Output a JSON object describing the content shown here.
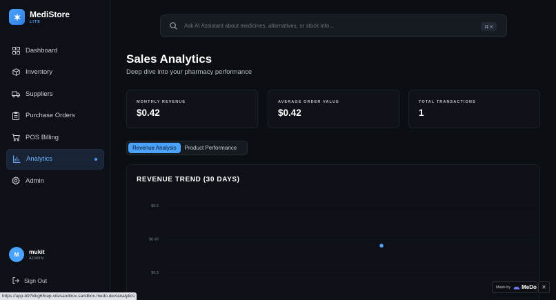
{
  "brand": {
    "name": "MediStore",
    "tagline": "LITE"
  },
  "nav": {
    "items": [
      {
        "label": "Dashboard",
        "icon": "grid-icon"
      },
      {
        "label": "Inventory",
        "icon": "package-icon"
      },
      {
        "label": "Suppliers",
        "icon": "truck-icon"
      },
      {
        "label": "Purchase Orders",
        "icon": "clipboard-icon"
      },
      {
        "label": "POS Billing",
        "icon": "cart-icon"
      },
      {
        "label": "Analytics",
        "icon": "bar-chart-icon",
        "active": true
      },
      {
        "label": "Admin",
        "icon": "gear-icon"
      }
    ]
  },
  "user": {
    "initial": "M",
    "name": "mukit",
    "role": "ADMIN"
  },
  "signout_label": "Sign Out",
  "search": {
    "placeholder": "Ask AI Assistant about medicines, alternatives, or stock info...",
    "shortcut": "⌘ K"
  },
  "page": {
    "title": "Sales Analytics",
    "subtitle": "Deep dive into your pharmacy performance"
  },
  "stats": [
    {
      "label": "MONTHLY REVENUE",
      "value": "$0.42"
    },
    {
      "label": "AVERAGE ORDER VALUE",
      "value": "$0.42"
    },
    {
      "label": "TOTAL TRANSACTIONS",
      "value": "1"
    }
  ],
  "tabs": [
    {
      "label": "Revenue Analysis",
      "active": true
    },
    {
      "label": "Product Performance",
      "active": false
    }
  ],
  "chart_data": {
    "type": "scatter",
    "title": "REVENUE TREND (30 DAYS)",
    "y_ticks": [
      {
        "value": 0.6,
        "label": "$0.6"
      },
      {
        "value": 0.45,
        "label": "$0.45"
      },
      {
        "value": 0.3,
        "label": "$0.3"
      }
    ],
    "ylim": [
      0,
      0.6
    ],
    "x_position_fraction": 0.5,
    "points": [
      {
        "y": 0.42
      }
    ],
    "point_color": "#4aa3ff",
    "grid": true
  },
  "status_url": "https://app-b97klkg65rep-vitesandbox.sandbox.medo.dev/analytics",
  "madeby": {
    "prefix": "Made by",
    "name": "MeDo",
    "close": "✕"
  },
  "colors": {
    "accent": "#4aa3ff",
    "background": "#0b0e13"
  }
}
